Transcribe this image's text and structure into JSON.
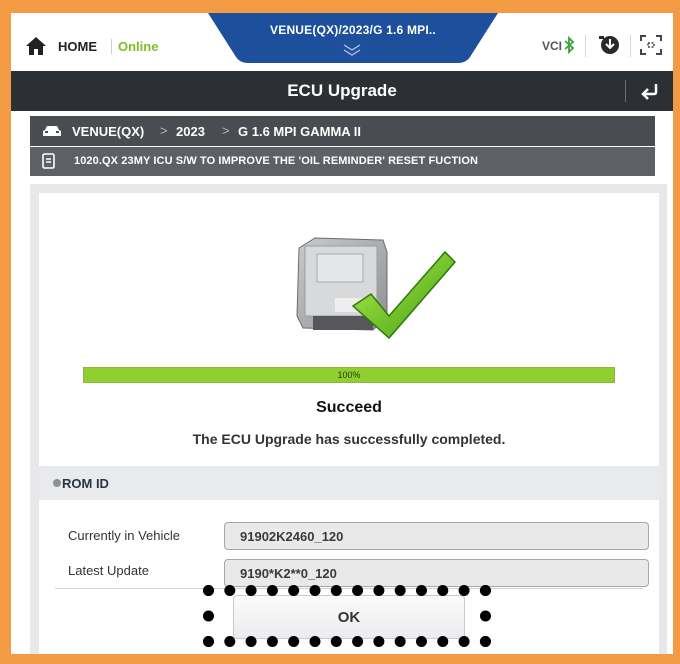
{
  "header": {
    "home_label": "HOME",
    "online_label": "Online",
    "vehicle_tab": "VENUE(QX)/2023/G 1.6 MPI..",
    "vci_label": "VCI"
  },
  "title": "ECU Upgrade",
  "breadcrumb": {
    "model": "VENUE(QX)",
    "year": "2023",
    "engine": "G 1.6 MPI GAMMA II",
    "separator": ">"
  },
  "description": "1020.QX 23MY ICU S/W TO IMPROVE THE 'OIL REMINDER' RESET FUCTION",
  "progress": {
    "value": 100,
    "label": "100%"
  },
  "status": {
    "title": "Succeed",
    "message": "The ECU Upgrade has successfully completed."
  },
  "rom": {
    "section_label": "ROM ID",
    "fields": [
      {
        "label": "Currently in Vehicle",
        "value": "91902K2460_120"
      },
      {
        "label": "Latest Update",
        "value": "9190*K2**0_120"
      }
    ]
  },
  "ok_label": "OK",
  "colors": {
    "accent_orange": "#f39a45",
    "tab_blue": "#1d4f9c",
    "online_green": "#7fbf26",
    "progress_green": "#8fcf2f",
    "titlebar": "#2c2f33"
  }
}
